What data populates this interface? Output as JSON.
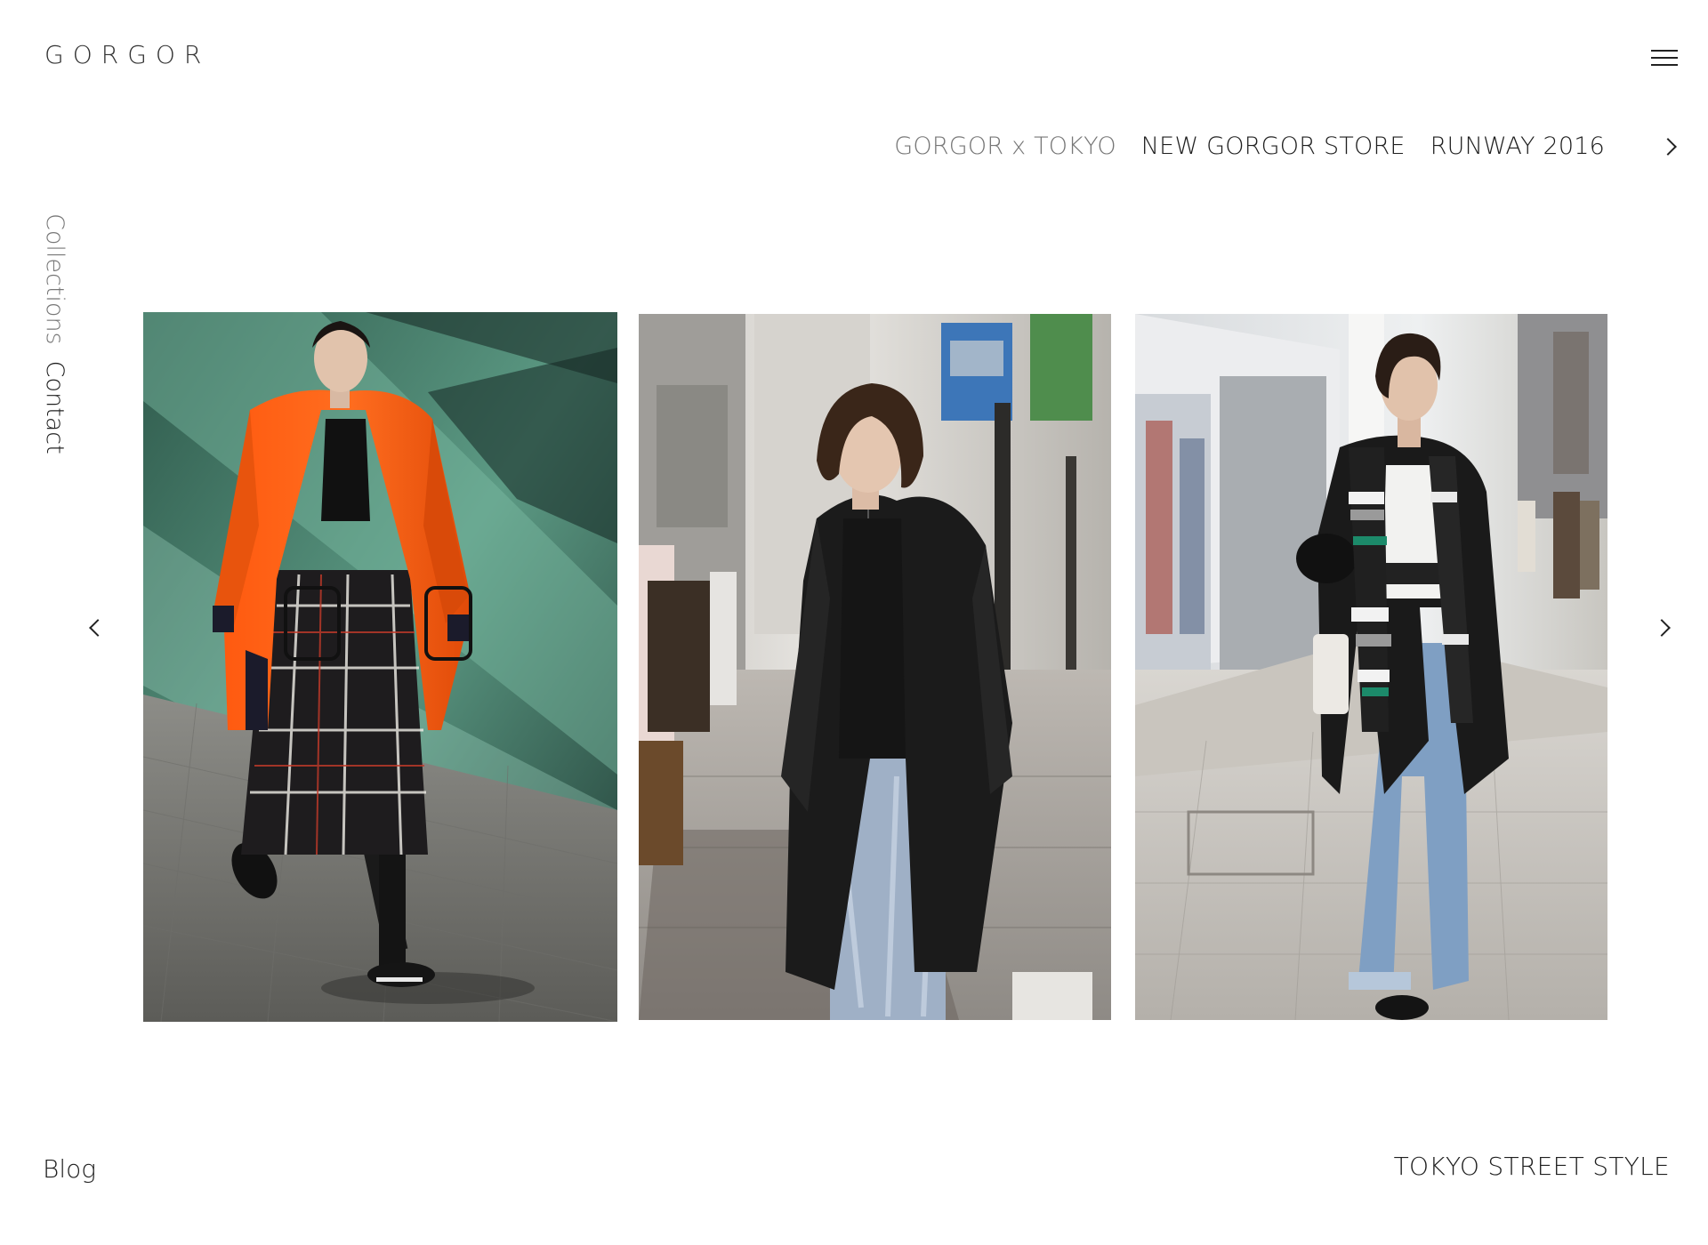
{
  "header": {
    "logo": "GORGOR"
  },
  "topnav": {
    "items": [
      {
        "label": "GORGOR x TOKYO",
        "active": true
      },
      {
        "label": "NEW GORGOR STORE",
        "active": false
      },
      {
        "label": "RUNWAY 2016",
        "active": false
      }
    ]
  },
  "sidenav": {
    "collections": "Collections",
    "contact": "Contact"
  },
  "footer": {
    "blog": "Blog",
    "caption": "TOKYO STREET STYLE"
  },
  "colors": {
    "text": "#1f1f1f",
    "muted": "#777777",
    "background": "#ffffff"
  },
  "icons": {
    "menu": "hamburger-icon",
    "next": "chevron-right-icon",
    "prev": "chevron-left-icon"
  }
}
